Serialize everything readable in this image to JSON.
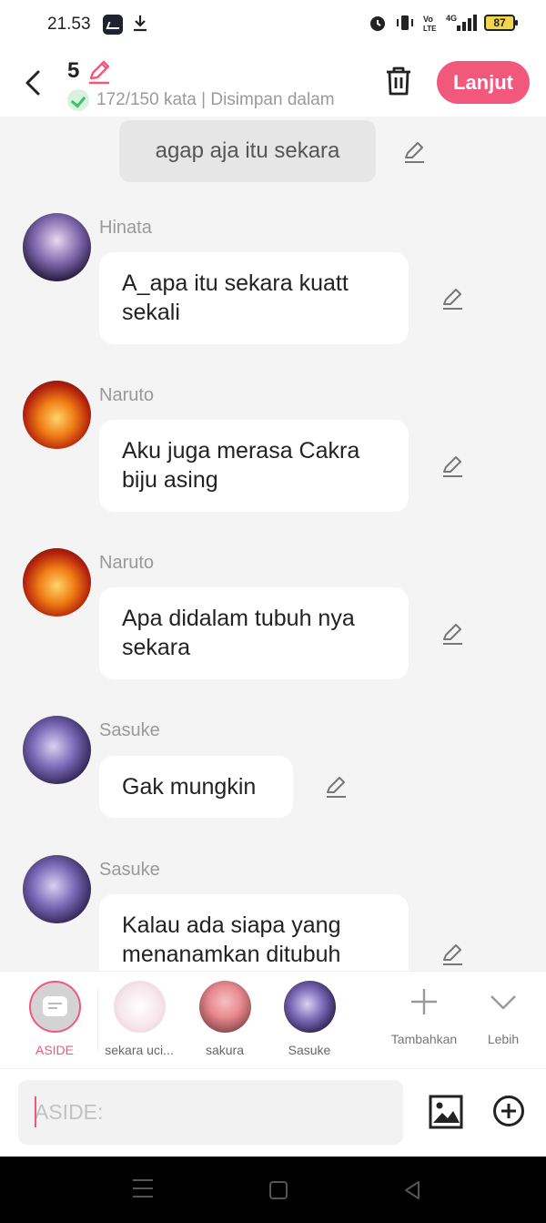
{
  "status": {
    "time": "21.53",
    "battery": "87",
    "network": "4G"
  },
  "header": {
    "episode": "5",
    "save_status": "172/150 kata | Disimpan dalam",
    "next_label": "Lanjut"
  },
  "chat": {
    "aside_text": "agap aja itu sekara",
    "messages": [
      {
        "name": "Hinata",
        "text": "A_apa itu sekara kuatt sekali"
      },
      {
        "name": "Naruto",
        "text": "Aku juga merasa Cakra biju asing"
      },
      {
        "name": "Naruto",
        "text": "Apa didalam tubuh nya sekara"
      },
      {
        "name": "Sasuke",
        "text": "Gak mungkin"
      },
      {
        "name": "Sasuke",
        "text": "Kalau ada siapa yang menanamkan ditubuh"
      }
    ]
  },
  "characters": [
    {
      "label": "ASIDE"
    },
    {
      "label": "sekara uci..."
    },
    {
      "label": "sakura"
    },
    {
      "label": "Sasuke"
    }
  ],
  "tools": {
    "add_label": "Tambahkan",
    "more_label": "Lebih"
  },
  "input": {
    "placeholder": "ASIDE:"
  },
  "colors": {
    "accent": "#f2587b",
    "success": "#3cc267"
  }
}
